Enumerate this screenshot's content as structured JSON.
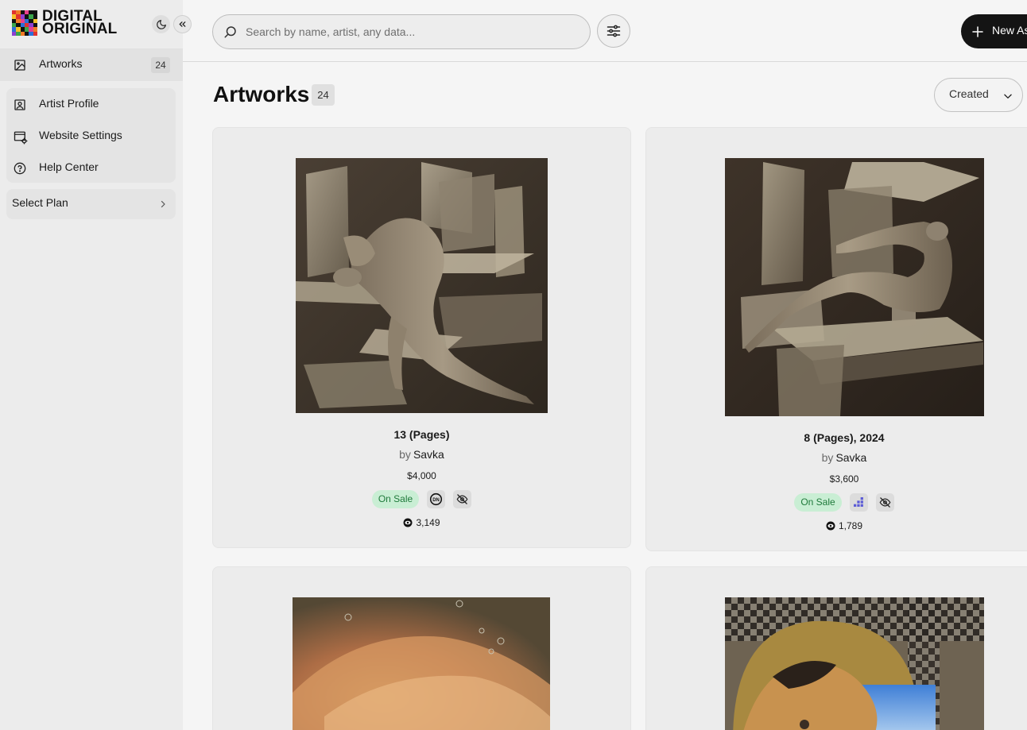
{
  "brand": {
    "line1": "DIGITAL",
    "line2": "ORIGINAL"
  },
  "sidebar": {
    "artworks": {
      "label": "Artworks",
      "count": "24"
    },
    "items": [
      {
        "label": "Artist Profile"
      },
      {
        "label": "Website Settings"
      },
      {
        "label": "Help Center"
      }
    ],
    "select_plan": "Select Plan"
  },
  "search": {
    "placeholder": "Search by name, artist, any data..."
  },
  "toolbar": {
    "new_label": "New As"
  },
  "main": {
    "title": "Artworks",
    "count": "24",
    "sort_label": "Created",
    "cards": [
      {
        "title": "13 (Pages)",
        "by": "by",
        "artist": "Savka",
        "price": "$4,000",
        "status": "On Sale",
        "views": "3,149",
        "badge_icon_1": "DN"
      },
      {
        "title": "8 (Pages), 2024",
        "by": "by",
        "artist": "Savka",
        "price": "$3,600",
        "status": "On Sale",
        "views": "1,789"
      }
    ]
  },
  "colors": {
    "accent": "#141414",
    "sale_bg": "#c9eed4",
    "sale_text": "#1f7a3b"
  }
}
